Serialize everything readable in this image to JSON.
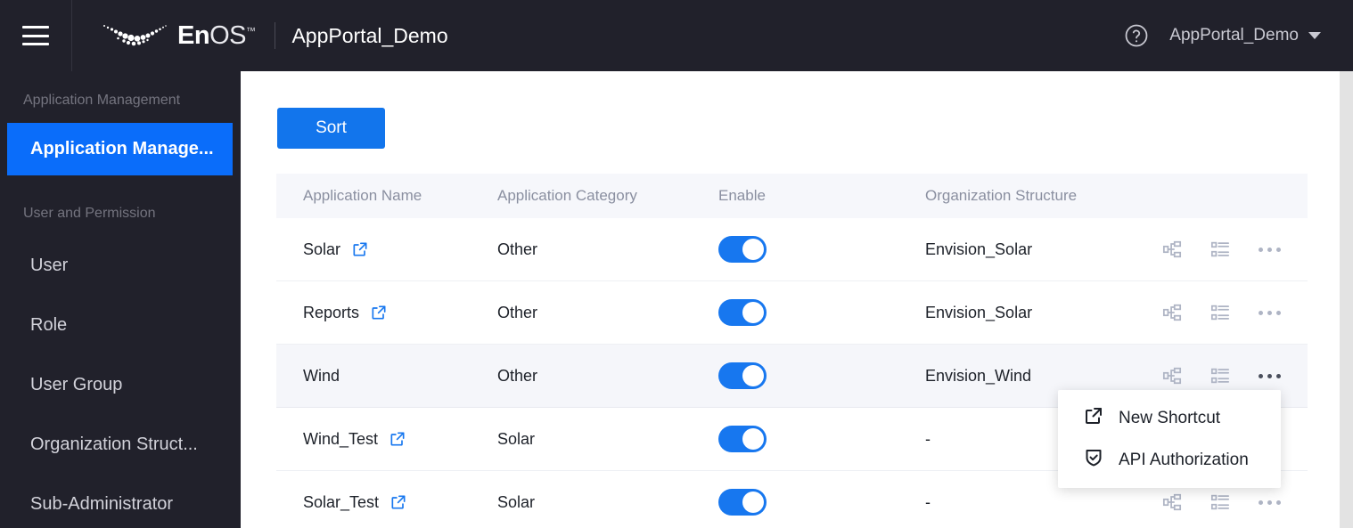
{
  "header": {
    "menu_icon": "hamburger-icon",
    "logo_text_bold": "En",
    "logo_text_light": "OS",
    "logo_tm": "™",
    "portal_title": "AppPortal_Demo",
    "help_icon": "question-circle-icon",
    "user_label": "AppPortal_Demo",
    "caret_icon": "chevron-down-icon",
    "bg_color": "#21212b"
  },
  "sidebar": {
    "groups": [
      {
        "title": "Application Management",
        "items": [
          {
            "label": "Application Manage...",
            "active": true
          }
        ]
      },
      {
        "title": "User and Permission",
        "items": [
          {
            "label": "User",
            "active": false
          },
          {
            "label": "Role",
            "active": false
          },
          {
            "label": "User Group",
            "active": false
          },
          {
            "label": "Organization Struct...",
            "active": false
          },
          {
            "label": "Sub-Administrator",
            "active": false
          }
        ]
      }
    ],
    "active_color": "#0a6dfa"
  },
  "toolbar": {
    "sort_label": "Sort",
    "sort_color": "#1275ec"
  },
  "table": {
    "columns": [
      "Application Name",
      "Application Category",
      "Enable",
      "Organization Structure"
    ],
    "rows": [
      {
        "name": "Solar",
        "has_link": true,
        "category": "Other",
        "enabled": true,
        "org": "Envision_Solar"
      },
      {
        "name": "Reports",
        "has_link": true,
        "category": "Other",
        "enabled": true,
        "org": "Envision_Solar"
      },
      {
        "name": "Wind",
        "has_link": false,
        "category": "Other",
        "enabled": true,
        "org": "Envision_Wind",
        "highlight": true
      },
      {
        "name": "Wind_Test",
        "has_link": true,
        "category": "Solar",
        "enabled": true,
        "org": "-"
      },
      {
        "name": "Solar_Test",
        "has_link": true,
        "category": "Solar",
        "enabled": true,
        "org": "-"
      }
    ],
    "row_action_icons": [
      "sitemap-icon",
      "list-icon",
      "ellipsis-icon"
    ],
    "toggle_on_color": "#1777ef"
  },
  "context_menu": {
    "items": [
      {
        "label": "New Shortcut",
        "icon": "external-link-icon"
      },
      {
        "label": "API Authorization",
        "icon": "shield-check-icon"
      }
    ]
  }
}
